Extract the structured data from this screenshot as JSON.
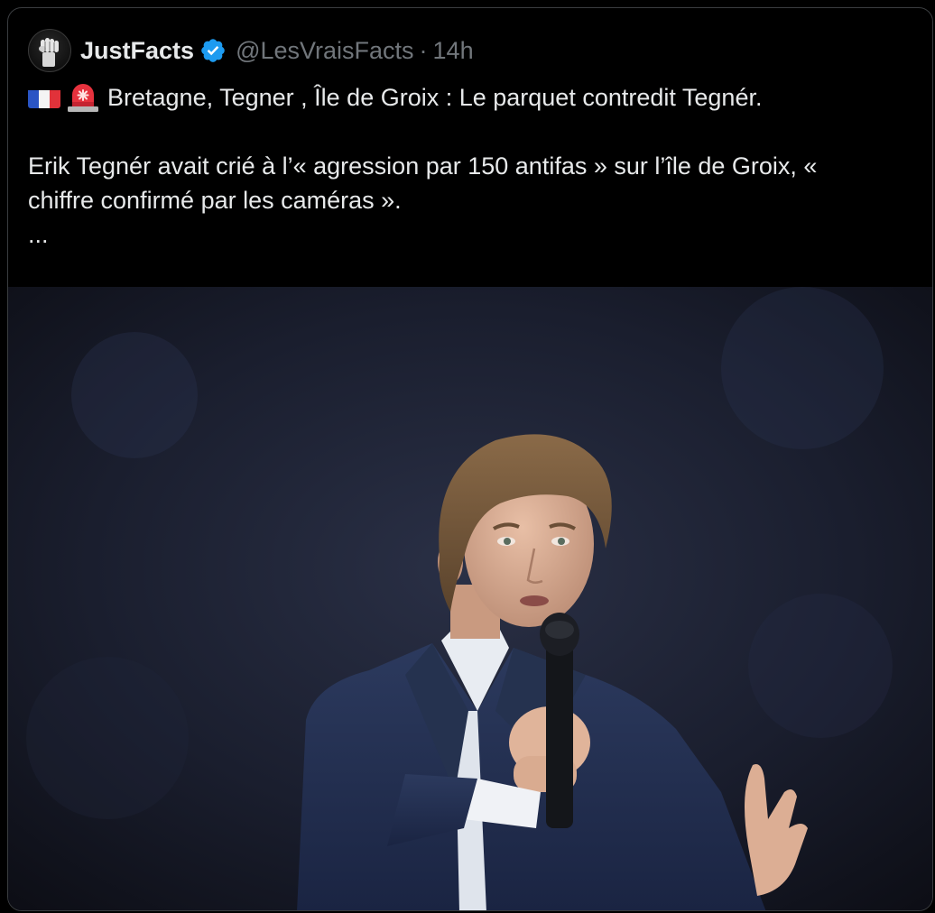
{
  "tweet": {
    "author": {
      "display_name": "JustFacts",
      "handle": "@LesVraisFacts",
      "verified": true,
      "avatar_icon": "raised-fist-icon"
    },
    "separator": "·",
    "timestamp": "14h",
    "text": {
      "line1": "Bretagne, Tegner , Île de Groix : Le parquet contredit Tegnér.",
      "line1_emojis": [
        "french-flag-icon",
        "rotating-light-icon"
      ],
      "line2": "Erik Tegnér avait crié à l’« agression par 150 antifas » sur l’île de Groix, «",
      "line3": "chiffre confirmé par les caméras ».",
      "line4": "..."
    },
    "media": {
      "type": "photo",
      "subject": "man in navy suit speaking into microphone on stage"
    }
  },
  "colors": {
    "background": "#000000",
    "text_primary": "#e7e9ea",
    "text_secondary": "#71767b",
    "verified_blue": "#1d9bf0",
    "border": "#3a3d40"
  }
}
